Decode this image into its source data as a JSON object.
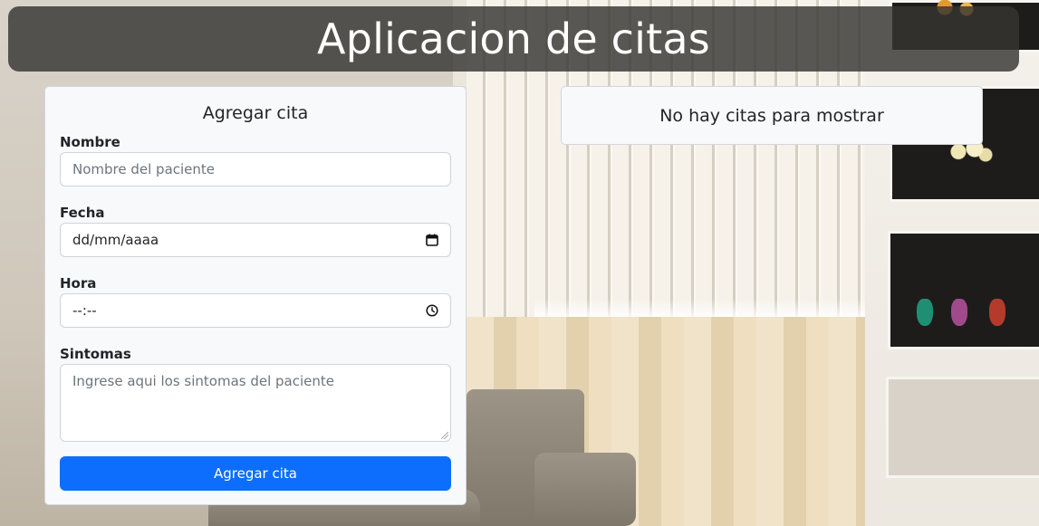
{
  "header": {
    "title": "Aplicacion de citas"
  },
  "form": {
    "title": "Agregar cita",
    "nombre": {
      "label": "Nombre",
      "placeholder": "Nombre del paciente"
    },
    "fecha": {
      "label": "Fecha",
      "value": "dd/mm/aaaa",
      "icon": "calendar-icon"
    },
    "hora": {
      "label": "Hora",
      "value": "--:--",
      "icon": "clock-icon"
    },
    "sintomas": {
      "label": "Sintomas",
      "placeholder": "Ingrese aqui los sintomas del paciente"
    },
    "submit_label": "Agregar cita"
  },
  "list": {
    "empty_message": "No hay citas para mostrar"
  },
  "colors": {
    "header_bg": "#363432",
    "card_bg": "#f8f9fa",
    "primary": "#0d6efd"
  }
}
